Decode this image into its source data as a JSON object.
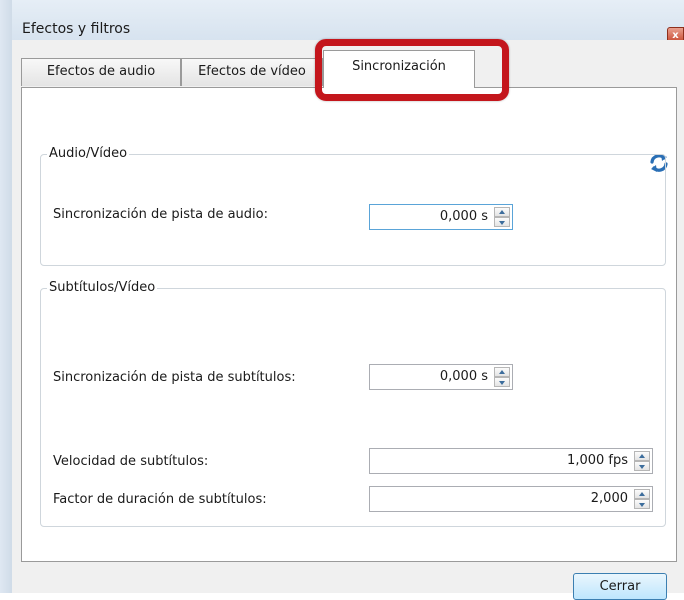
{
  "window": {
    "title": "Efectos y filtros",
    "close_glyph": "x"
  },
  "tabs": [
    {
      "label": "Efectos de audio",
      "active": false
    },
    {
      "label": "Efectos de vídeo",
      "active": false
    },
    {
      "label": "Sincronización",
      "active": true
    }
  ],
  "highlight": {
    "color": "#c4161c"
  },
  "toolbar": {
    "refresh_icon": "sync-icon"
  },
  "audio_video": {
    "group_title": "Audio/Vídeo",
    "audio_track_sync": {
      "label": "Sincronización de pista de audio:",
      "value": "0,000 s"
    }
  },
  "subtitles_video": {
    "group_title": "Subtítulos/Vídeo",
    "subtitle_track_sync": {
      "label": "Sincronización de pista de subtítulos:",
      "value": "0,000 s"
    },
    "subtitle_speed": {
      "label": "Velocidad de subtítulos:",
      "value": "1,000 fps"
    },
    "subtitle_duration_factor": {
      "label": "Factor de duración de subtítulos:",
      "value": "2,000"
    }
  },
  "footer": {
    "close_label": "Cerrar"
  }
}
